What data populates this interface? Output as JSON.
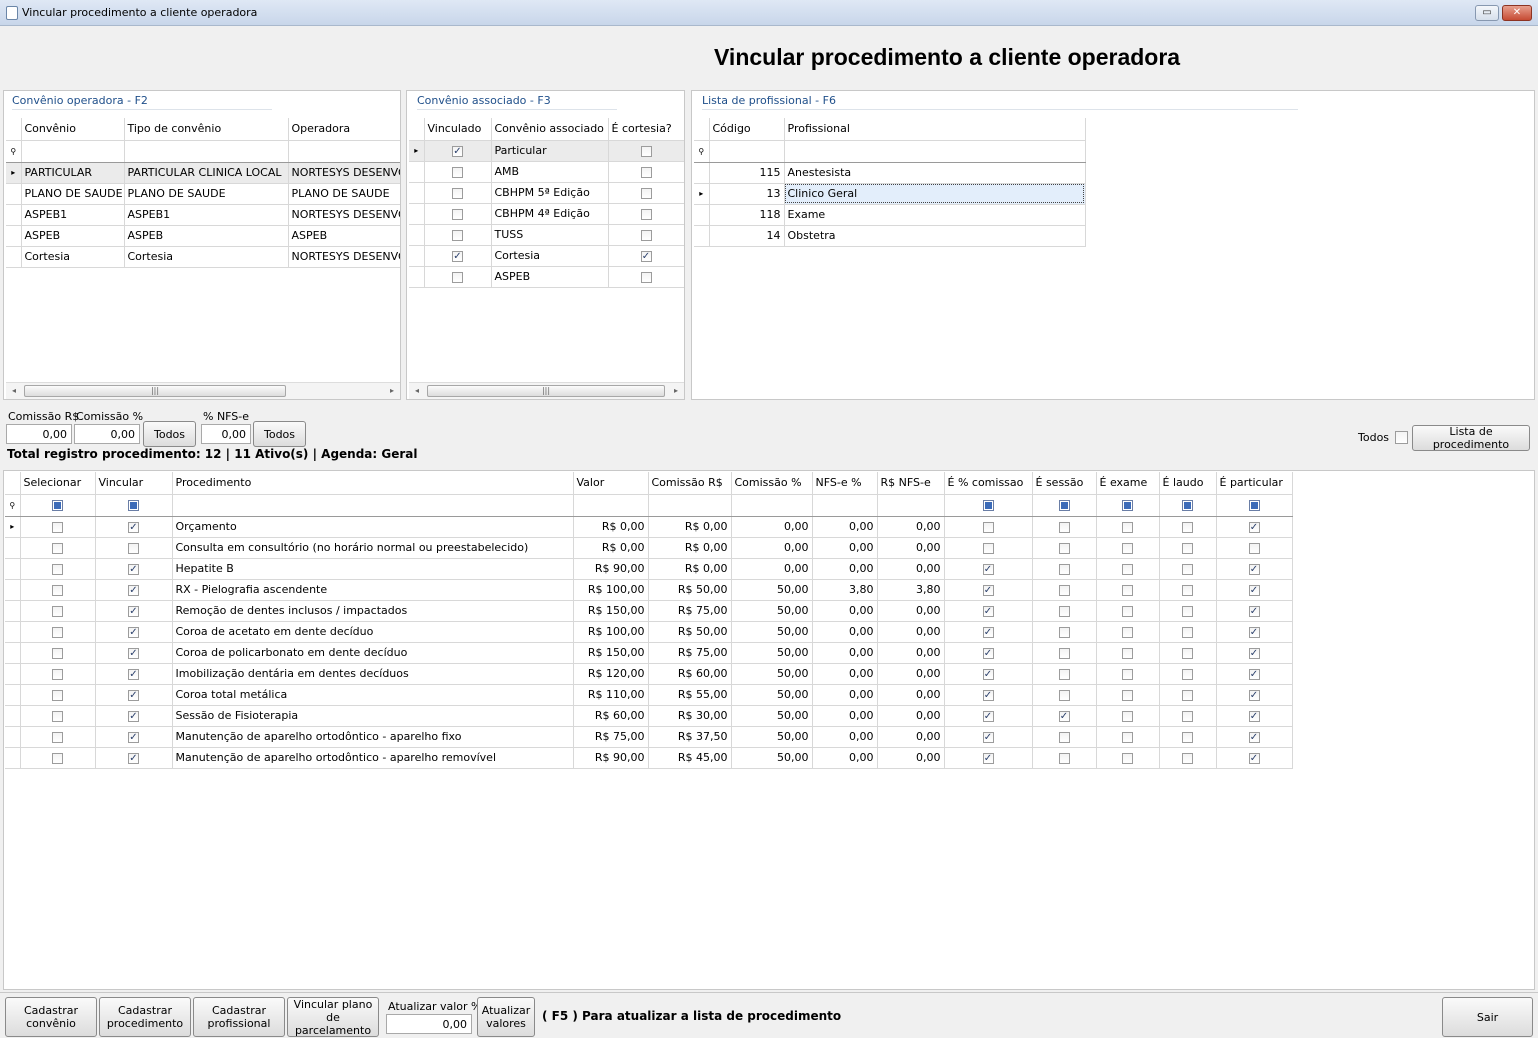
{
  "window": {
    "title": "Vincular procedimento a cliente operadora",
    "restore": "▭",
    "close": "✕"
  },
  "heading": "Vincular procedimento a cliente operadora",
  "convenio_operadora": {
    "title": "Convênio operadora - F2",
    "columns": [
      "Convênio",
      "Tipo de convênio",
      "Operadora"
    ],
    "rows": [
      [
        "PARTICULAR",
        "PARTICULAR CLINICA LOCAL",
        "NORTESYS DESENVOLVIMENTO"
      ],
      [
        "PLANO DE SAUDE",
        "PLANO DE SAUDE",
        "PLANO DE SAUDE"
      ],
      [
        "ASPEB1",
        "ASPEB1",
        "NORTESYS DESENVOLVIMENTO"
      ],
      [
        "ASPEB",
        "ASPEB",
        "ASPEB"
      ],
      [
        "Cortesia",
        "Cortesia",
        "NORTESYS DESENVOLVIMENTO"
      ]
    ]
  },
  "convenio_associado": {
    "title": "Convênio associado - F3",
    "columns": [
      "Vinculado",
      "Convênio associado",
      "É cortesia?"
    ],
    "rows": [
      {
        "vinculado": true,
        "nome": "Particular",
        "cortesia": false
      },
      {
        "vinculado": false,
        "nome": "AMB",
        "cortesia": false
      },
      {
        "vinculado": false,
        "nome": "CBHPM 5ª Edição",
        "cortesia": false
      },
      {
        "vinculado": false,
        "nome": "CBHPM 4ª Edição",
        "cortesia": false
      },
      {
        "vinculado": false,
        "nome": "TUSS",
        "cortesia": false
      },
      {
        "vinculado": true,
        "nome": "Cortesia",
        "cortesia": true
      },
      {
        "vinculado": false,
        "nome": "ASPEB",
        "cortesia": false
      }
    ]
  },
  "profissionais": {
    "title": "Lista de profissional - F6",
    "columns": [
      "Código",
      "Profissional"
    ],
    "rows": [
      [
        "115",
        "Anestesista"
      ],
      [
        "13",
        "Clinico Geral"
      ],
      [
        "118",
        "Exame"
      ],
      [
        "14",
        "Obstetra"
      ]
    ]
  },
  "controls": {
    "comissao_rs_label": "Comissão R$",
    "comissao_rs_value": "0,00",
    "comissao_pct_label": "Comissão %",
    "comissao_pct_value": "0,00",
    "todos_btn1": "Todos",
    "nfse_label": "% NFS-e",
    "nfse_value": "0,00",
    "todos_btn2": "Todos",
    "todos_label": "Todos",
    "lista_btn": "Lista de procedimento",
    "total_text": "Total registro procedimento: 12  |  11 Ativo(s)  |  Agenda: Geral"
  },
  "procedimentos": {
    "columns": [
      "Selecionar",
      "Vincular",
      "Procedimento",
      "Valor",
      "Comissão R$",
      "Comissão %",
      "NFS-e %",
      "R$ NFS-e",
      "É % comissao",
      "É sessão",
      "É exame",
      "É laudo",
      "É particular"
    ],
    "rows": [
      {
        "sel": false,
        "vinc": true,
        "nome": "Orçamento",
        "valor": "R$ 0,00",
        "com_rs": "R$ 0,00",
        "com_pct": "0,00",
        "nfse_pct": "0,00",
        "rs_nfse": "0,00",
        "pct_com": false,
        "sessao": false,
        "exame": false,
        "laudo": false,
        "particular": true
      },
      {
        "sel": false,
        "vinc": false,
        "nome": "Consulta em consultório (no horário normal ou preestabelecido)",
        "valor": "R$ 0,00",
        "com_rs": "R$ 0,00",
        "com_pct": "0,00",
        "nfse_pct": "0,00",
        "rs_nfse": "0,00",
        "pct_com": false,
        "sessao": false,
        "exame": false,
        "laudo": false,
        "particular": false
      },
      {
        "sel": false,
        "vinc": true,
        "nome": "Hepatite B",
        "valor": "R$ 90,00",
        "com_rs": "R$ 0,00",
        "com_pct": "0,00",
        "nfse_pct": "0,00",
        "rs_nfse": "0,00",
        "pct_com": true,
        "sessao": false,
        "exame": false,
        "laudo": false,
        "particular": true
      },
      {
        "sel": false,
        "vinc": true,
        "nome": "RX - Pielografia ascendente",
        "valor": "R$ 100,00",
        "com_rs": "R$ 50,00",
        "com_pct": "50,00",
        "nfse_pct": "3,80",
        "rs_nfse": "3,80",
        "pct_com": true,
        "sessao": false,
        "exame": false,
        "laudo": false,
        "particular": true
      },
      {
        "sel": false,
        "vinc": true,
        "nome": "Remoção de dentes inclusos / impactados",
        "valor": "R$ 150,00",
        "com_rs": "R$ 75,00",
        "com_pct": "50,00",
        "nfse_pct": "0,00",
        "rs_nfse": "0,00",
        "pct_com": true,
        "sessao": false,
        "exame": false,
        "laudo": false,
        "particular": true
      },
      {
        "sel": false,
        "vinc": true,
        "nome": "Coroa de acetato em dente decíduo",
        "valor": "R$ 100,00",
        "com_rs": "R$ 50,00",
        "com_pct": "50,00",
        "nfse_pct": "0,00",
        "rs_nfse": "0,00",
        "pct_com": true,
        "sessao": false,
        "exame": false,
        "laudo": false,
        "particular": true
      },
      {
        "sel": false,
        "vinc": true,
        "nome": "Coroa de policarbonato em dente decíduo",
        "valor": "R$ 150,00",
        "com_rs": "R$ 75,00",
        "com_pct": "50,00",
        "nfse_pct": "0,00",
        "rs_nfse": "0,00",
        "pct_com": true,
        "sessao": false,
        "exame": false,
        "laudo": false,
        "particular": true
      },
      {
        "sel": false,
        "vinc": true,
        "nome": "Imobilização dentária em dentes decíduos",
        "valor": "R$ 120,00",
        "com_rs": "R$ 60,00",
        "com_pct": "50,00",
        "nfse_pct": "0,00",
        "rs_nfse": "0,00",
        "pct_com": true,
        "sessao": false,
        "exame": false,
        "laudo": false,
        "particular": true
      },
      {
        "sel": false,
        "vinc": true,
        "nome": "Coroa total metálica",
        "valor": "R$ 110,00",
        "com_rs": "R$ 55,00",
        "com_pct": "50,00",
        "nfse_pct": "0,00",
        "rs_nfse": "0,00",
        "pct_com": true,
        "sessao": false,
        "exame": false,
        "laudo": false,
        "particular": true
      },
      {
        "sel": false,
        "vinc": true,
        "nome": "Sessão de Fisioterapia",
        "valor": "R$ 60,00",
        "com_rs": "R$ 30,00",
        "com_pct": "50,00",
        "nfse_pct": "0,00",
        "rs_nfse": "0,00",
        "pct_com": true,
        "sessao": true,
        "exame": false,
        "laudo": false,
        "particular": true
      },
      {
        "sel": false,
        "vinc": true,
        "nome": "Manutenção de aparelho ortodôntico - aparelho fixo",
        "valor": "R$ 75,00",
        "com_rs": "R$ 37,50",
        "com_pct": "50,00",
        "nfse_pct": "0,00",
        "rs_nfse": "0,00",
        "pct_com": true,
        "sessao": false,
        "exame": false,
        "laudo": false,
        "particular": true
      },
      {
        "sel": false,
        "vinc": true,
        "nome": "Manutenção de aparelho ortodôntico - aparelho removível",
        "valor": "R$ 90,00",
        "com_rs": "R$ 45,00",
        "com_pct": "50,00",
        "nfse_pct": "0,00",
        "rs_nfse": "0,00",
        "pct_com": true,
        "sessao": false,
        "exame": false,
        "laudo": false,
        "particular": true
      }
    ]
  },
  "footer": {
    "cad_convenio_1": "Cadastrar",
    "cad_convenio_2": "convênio",
    "cad_proc_1": "Cadastrar",
    "cad_proc_2": "procedimento",
    "cad_prof_1": "Cadastrar",
    "cad_prof_2": "profissional",
    "vinc_plano_1": "Vincular plano de",
    "vinc_plano_2": "parcelamento",
    "atualizar_pct_label": "Atualizar valor %",
    "atualizar_pct_value": "0,00",
    "atualizar_valores_1": "Atualizar",
    "atualizar_valores_2": "valores",
    "hint": "( F5 ) Para atualizar a lista de procedimento",
    "sair": "Sair"
  },
  "icons": {
    "row_indicator": "▸",
    "filter": "funnel-icon"
  }
}
